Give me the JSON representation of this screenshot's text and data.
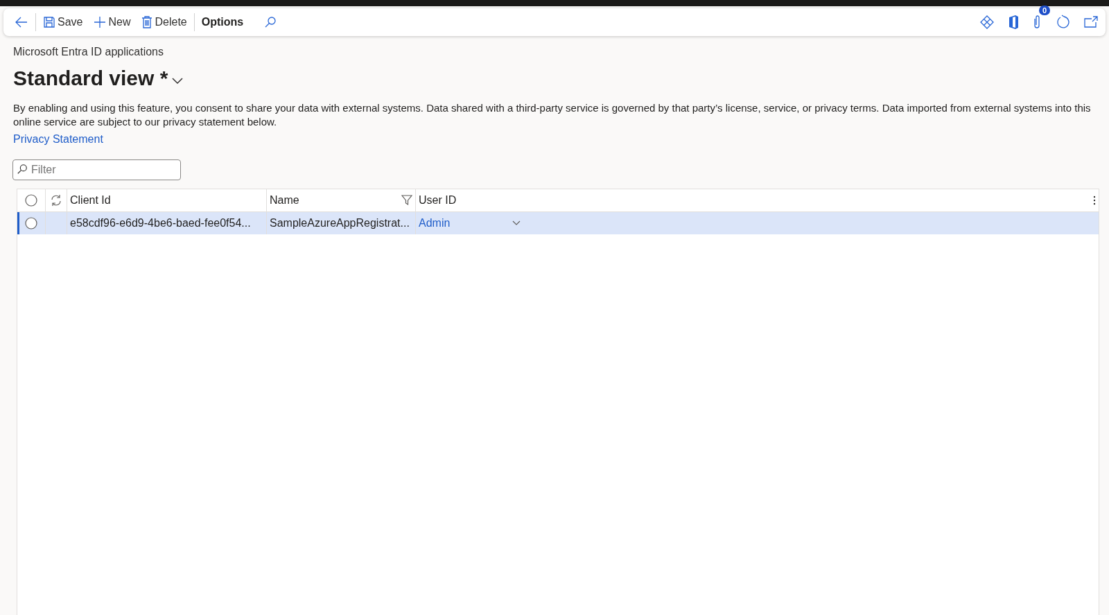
{
  "toolbar": {
    "actions": [
      {
        "kind": "save",
        "label": "Save"
      },
      {
        "kind": "new",
        "label": "New"
      },
      {
        "kind": "delete",
        "label": "Delete"
      },
      {
        "kind": "options",
        "label": "Options"
      }
    ],
    "badge": "0"
  },
  "page": {
    "title": "Microsoft Entra ID applications",
    "view": "Standard view *",
    "notice": "By enabling and using this feature, you consent to share your data with external systems. Data shared with a third-party service is governed by that party’s license, service, or privacy terms. Data imported from external systems into this online service are subject to our privacy statement below.",
    "link": "Privacy Statement"
  },
  "filter": {
    "placeholder": "Filter"
  },
  "table": {
    "select_all": false,
    "columns": [
      "Client Id",
      "Name",
      "User ID"
    ],
    "rows": [
      {
        "client_id": "e58cdf96-e6d9-4be6-baed-fee0f54...",
        "name": "SampleAzureAppRegistrat...",
        "user_id": "Admin",
        "selected": true
      }
    ]
  }
}
